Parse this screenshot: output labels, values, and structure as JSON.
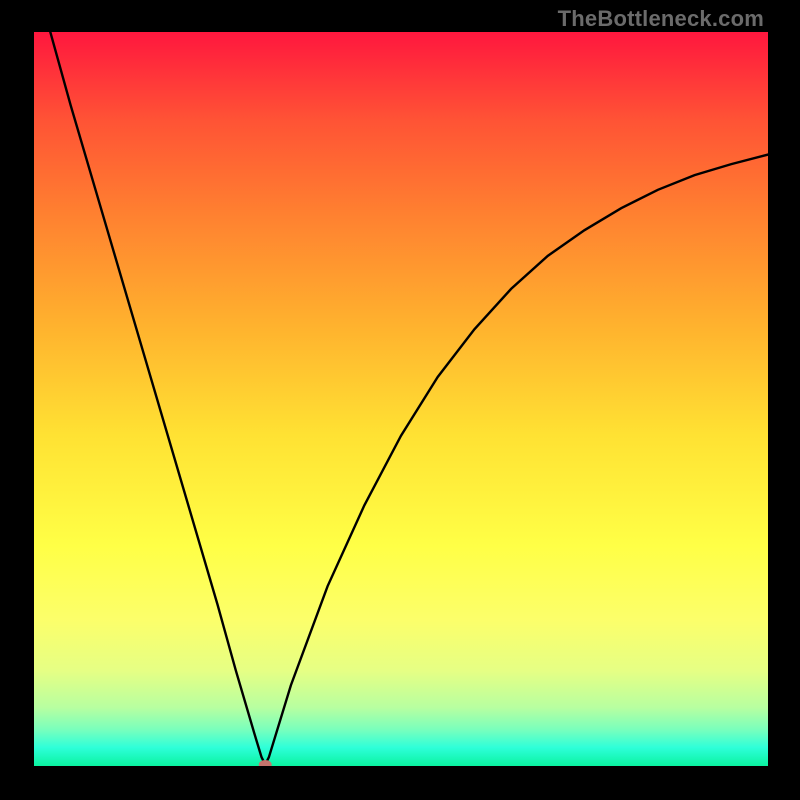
{
  "watermark": "TheBottleneck.com",
  "chart_data": {
    "type": "line",
    "title": "",
    "xlabel": "",
    "ylabel": "",
    "xlim": [
      0,
      100
    ],
    "ylim": [
      0,
      100
    ],
    "grid": false,
    "series": [
      {
        "name": "bottleneck-curve",
        "x": [
          0,
          5,
          10,
          15,
          20,
          25,
          27.5,
          30,
          31,
          31.5,
          32,
          35,
          40,
          45,
          50,
          55,
          60,
          65,
          70,
          75,
          80,
          85,
          90,
          95,
          100
        ],
        "y": [
          108,
          90,
          73,
          56,
          39,
          22,
          13,
          4.5,
          1.2,
          0.2,
          1.2,
          11,
          24.5,
          35.5,
          45,
          53,
          59.5,
          65,
          69.5,
          73,
          76,
          78.5,
          80.5,
          82,
          83.3
        ]
      }
    ],
    "marker": {
      "x": 31.5,
      "y": 0.2,
      "color": "#c4746d"
    },
    "background_gradient": {
      "top": "#ff173e",
      "bottom": "#0af3a0"
    }
  }
}
